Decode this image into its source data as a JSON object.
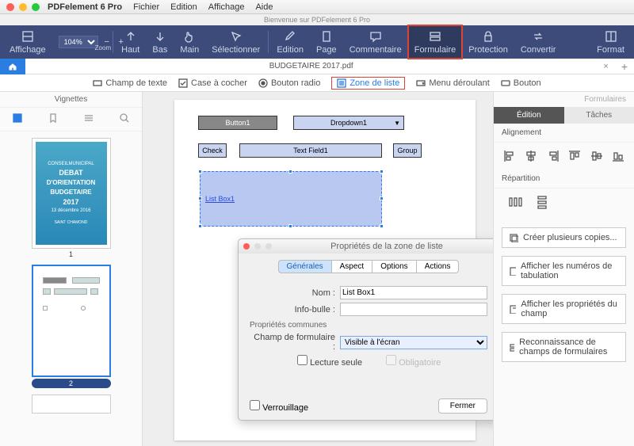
{
  "app": {
    "title": "PDFelement 6 Pro"
  },
  "menu": [
    "Fichier",
    "Edition",
    "Affichage",
    "Aide"
  ],
  "subtitle": "Bienvenue sur PDFelement 6 Pro",
  "toolbar": {
    "zoom_value": "104%",
    "zoom_label": "Zoom",
    "items": [
      "Affichage",
      "Haut",
      "Bas",
      "Main",
      "Sélectionner",
      "Edition",
      "Page",
      "Commentaire",
      "Formulaire",
      "Protection",
      "Convertir",
      "Format"
    ]
  },
  "doc_tab": "BUDGETAIRE 2017.pdf",
  "form_toolbar": [
    "Champ de texte",
    "Case à cocher",
    "Bouton radio",
    "Zone de liste",
    "Menu déroulant",
    "Bouton"
  ],
  "left": {
    "title": "Vignettes",
    "pages": [
      "1",
      "2"
    ]
  },
  "thumbnail1": {
    "l1": "CONSEILMUNICIPAL",
    "l2": "DEBAT",
    "l3": "D'ORIENTATION",
    "l4": "BUDGETAIRE",
    "l5": "2017",
    "l6": "13 décembre 2016",
    "l7": "SAINT CHAMOND"
  },
  "fields": {
    "button": "Button1",
    "dropdown": "Dropdown1",
    "check": "Check",
    "textfield": "Text Field1",
    "group": "Group",
    "listbox": "List Box1"
  },
  "dialog": {
    "title": "Propriétés de la zone de liste",
    "tabs": [
      "Générales",
      "Aspect",
      "Options",
      "Actions"
    ],
    "name_label": "Nom :",
    "name_value": "List Box1",
    "tooltip_label": "Info-bulle :",
    "tooltip_value": "",
    "section": "Propriétés communes",
    "ff_label": "Champ de formulaire :",
    "ff_value": "Visible à l'écran",
    "readonly": "Lecture seule",
    "required": "Obligatoire",
    "lock": "Verrouillage",
    "close": "Fermer"
  },
  "right": {
    "title": "Formulaires",
    "tabs": [
      "Édition",
      "Tâches"
    ],
    "align": "Alignement",
    "dist": "Répartition",
    "btns": [
      "Créer plusieurs copies...",
      "Afficher les numéros de tabulation",
      "Afficher les propriétés du champ",
      "Reconnaissance de champs de formulaires"
    ]
  }
}
